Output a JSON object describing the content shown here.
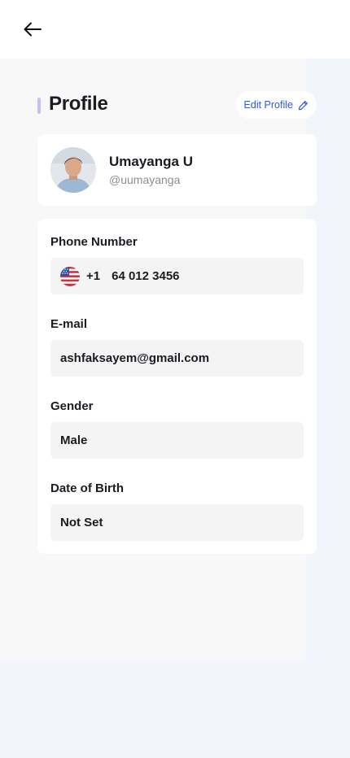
{
  "header": {
    "back_icon": "arrow-left-icon",
    "title": "Profile",
    "edit_label": "Edit Profile",
    "edit_icon": "pencil-icon"
  },
  "user": {
    "name": "Umayanga U",
    "handle": "@uumayanga"
  },
  "fields": {
    "phone": {
      "label": "Phone Number",
      "flag_icon": "us-flag-icon",
      "dial_code": "+1",
      "number": "64 012 3456"
    },
    "email": {
      "label": "E-mail",
      "value": "ashfaksayem@gmail.com"
    },
    "gender": {
      "label": "Gender",
      "value": "Male"
    },
    "dob": {
      "label": "Date of Birth",
      "value": "Not Set"
    }
  },
  "colors": {
    "accent": "#2F5BD3",
    "title_bar": "#C6BFF5",
    "background": "#F2F5FC",
    "panel": "#F8F8F8",
    "input": "#F4F4F4"
  }
}
